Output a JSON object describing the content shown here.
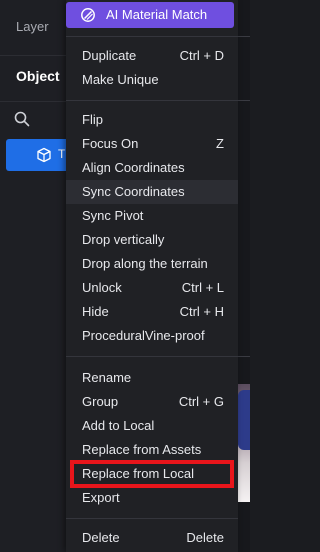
{
  "left_panel": {
    "layer_label": "Layer",
    "object_label": "Object",
    "row_text": "T"
  },
  "menu": {
    "header": {
      "label": "AI Material Match",
      "icon": "ai-icon"
    },
    "items": [
      {
        "label": "Duplicate",
        "shortcut": "Ctrl + D"
      },
      {
        "label": "Make Unique",
        "shortcut": ""
      },
      {
        "label": "Flip",
        "shortcut": ""
      },
      {
        "label": "Focus On",
        "shortcut": "Z"
      },
      {
        "label": "Align Coordinates",
        "shortcut": ""
      },
      {
        "label": "Sync Coordinates",
        "shortcut": "",
        "highlighted": true
      },
      {
        "label": "Sync Pivot",
        "shortcut": ""
      },
      {
        "label": "Drop vertically",
        "shortcut": ""
      },
      {
        "label": "Drop along the terrain",
        "shortcut": ""
      },
      {
        "label": "Unlock",
        "shortcut": "Ctrl + L"
      },
      {
        "label": "Hide",
        "shortcut": "Ctrl + H"
      },
      {
        "label": "ProceduralVine-proof",
        "shortcut": ""
      },
      {
        "label": "Rename",
        "shortcut": ""
      },
      {
        "label": "Group",
        "shortcut": "Ctrl + G"
      },
      {
        "label": "Add to Local",
        "shortcut": ""
      },
      {
        "label": "Replace from Assets",
        "shortcut": ""
      },
      {
        "label": "Replace from Local",
        "shortcut": "",
        "annotated": true
      },
      {
        "label": "Export",
        "shortcut": ""
      },
      {
        "label": "Delete",
        "shortcut": "Delete"
      }
    ]
  },
  "colors": {
    "menu_bg": "#202125",
    "header_accent": "#6f4fe0",
    "selection_blue": "#1f6ee6",
    "annotation_red": "#e8151b"
  }
}
